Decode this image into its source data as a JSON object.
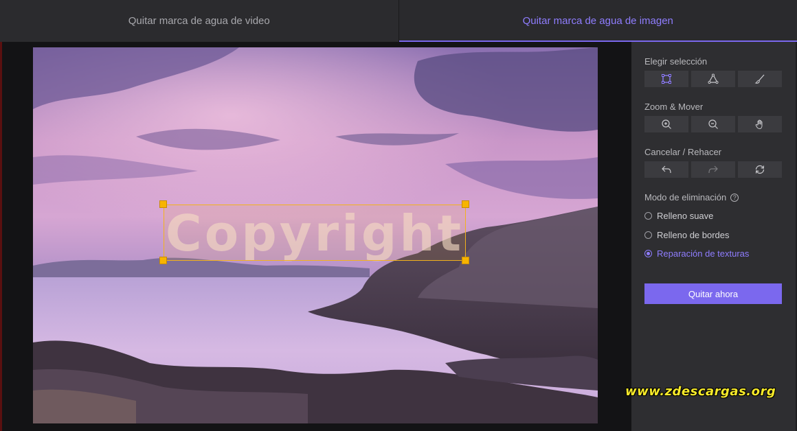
{
  "tabs": [
    {
      "label": "Quitar marca de agua de video",
      "active": false
    },
    {
      "label": "Quitar marca de agua de imagen",
      "active": true
    }
  ],
  "canvas": {
    "watermark_text": "Copyright",
    "selection_color": "#f3b21c"
  },
  "panel": {
    "selection": {
      "label": "Elegir selección",
      "tools": [
        "rectangle-select-icon",
        "polygon-select-icon",
        "brush-icon"
      ]
    },
    "zoom": {
      "label": "Zoom & Mover",
      "tools": [
        "zoom-in-icon",
        "zoom-out-icon",
        "hand-icon"
      ]
    },
    "undo": {
      "label": "Cancelar / Rehacer",
      "tools": [
        "undo-icon",
        "redo-icon",
        "reset-icon"
      ]
    },
    "mode": {
      "label": "Modo de eliminación",
      "help": "?",
      "options": [
        {
          "label": "Relleno suave",
          "selected": false
        },
        {
          "label": "Relleno de bordes",
          "selected": false
        },
        {
          "label": "Reparación de texturas",
          "selected": true
        }
      ]
    },
    "remove_button": "Quitar ahora"
  },
  "overlay": {
    "site_watermark": "www.zdescargas.org"
  },
  "colors": {
    "accent": "#7b68ee",
    "accent_text": "#8f7dff",
    "panel_bg": "#2e2e31"
  }
}
